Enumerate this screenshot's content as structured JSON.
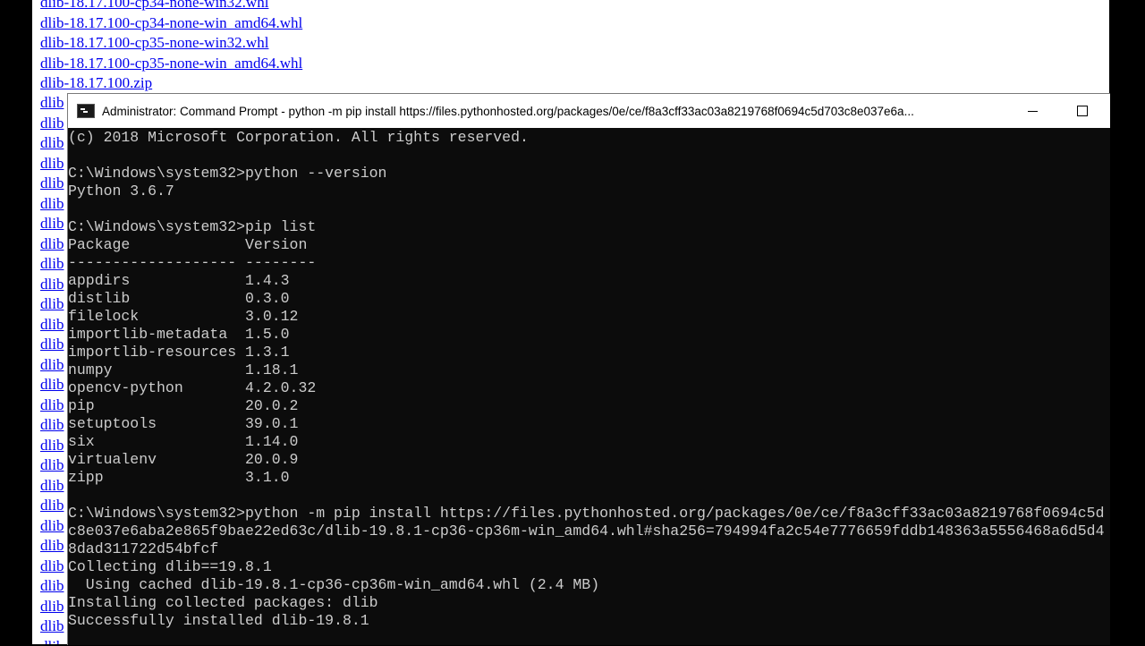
{
  "browser": {
    "links": [
      "dlib-18.17.100-cp34-none-win32.whl",
      "dlib-18.17.100-cp34-none-win_amd64.whl",
      "dlib-18.17.100-cp35-none-win32.whl",
      "dlib-18.17.100-cp35-none-win_amd64.whl",
      "dlib-18.17.100.zip"
    ],
    "stub_text": "dlib"
  },
  "cmd": {
    "title": "Administrator: Command Prompt - python  -m pip install https://files.pythonhosted.org/packages/0e/ce/f8a3cff33ac03a8219768f0694c5d703c8e037e6a...",
    "minimize_glyph": "minimize-icon",
    "maximize_glyph": "maximize-icon",
    "lines": [
      "(c) 2018 Microsoft Corporation. All rights reserved.",
      "",
      "C:\\Windows\\system32>python --version",
      "Python 3.6.7",
      "",
      "C:\\Windows\\system32>pip list",
      "Package             Version",
      "------------------- --------",
      "appdirs             1.4.3",
      "distlib             0.3.0",
      "filelock            3.0.12",
      "importlib-metadata  1.5.0",
      "importlib-resources 1.3.1",
      "numpy               1.18.1",
      "opencv-python       4.2.0.32",
      "pip                 20.0.2",
      "setuptools          39.0.1",
      "six                 1.14.0",
      "virtualenv          20.0.9",
      "zipp                3.1.0",
      "",
      "C:\\Windows\\system32>python -m pip install https://files.pythonhosted.org/packages/0e/ce/f8a3cff33ac03a8219768f0694c5d",
      "c8e037e6aba2e865f9bae22ed63c/dlib-19.8.1-cp36-cp36m-win_amd64.whl#sha256=794994fa2c54e7776659fddb148363a5556468a6d5d4",
      "8dad311722d54bfcf",
      "Collecting dlib==19.8.1",
      "  Using cached dlib-19.8.1-cp36-cp36m-win_amd64.whl (2.4 MB)",
      "Installing collected packages: dlib",
      "Successfully installed dlib-19.8.1"
    ]
  },
  "colors": {
    "console_bg": "#0c0c0c",
    "console_text": "#cccccc",
    "link": "#0000ee"
  }
}
